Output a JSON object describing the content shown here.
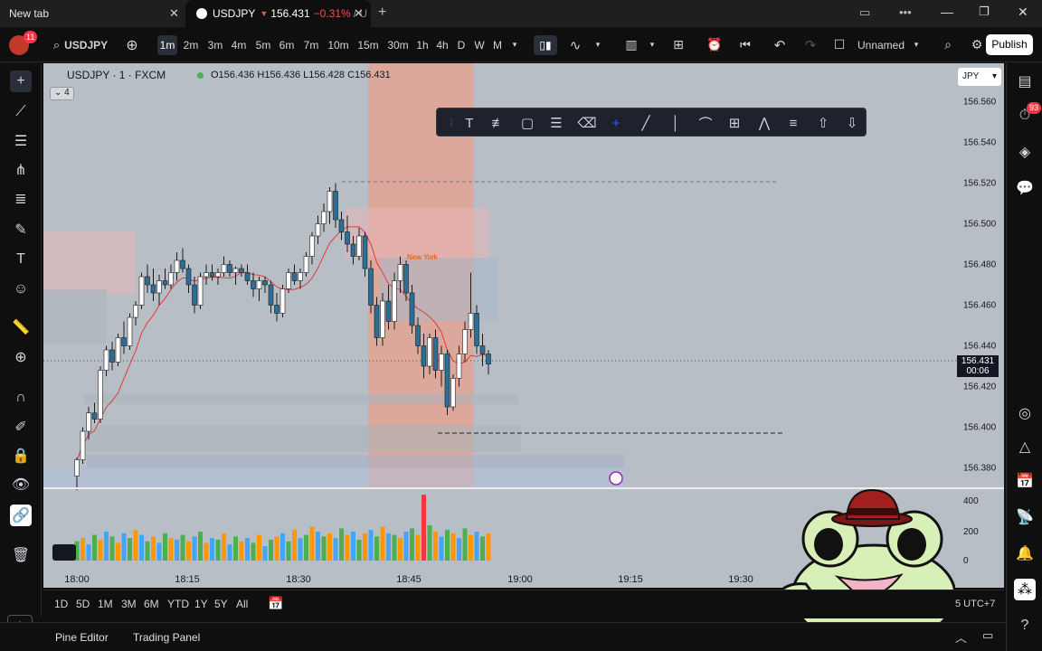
{
  "browser": {
    "tabs": [
      {
        "title": "New tab"
      },
      {
        "title": "USDJPY",
        "price": "156.431",
        "change": "−0.31%",
        "suffix": "/ U"
      }
    ]
  },
  "toolbar": {
    "notif_count": "11",
    "symbol": "USDJPY",
    "timeframes": [
      "1m",
      "2m",
      "3m",
      "4m",
      "5m",
      "6m",
      "7m",
      "10m",
      "15m",
      "30m",
      "1h",
      "4h",
      "D",
      "W",
      "M"
    ],
    "active_timeframe": "1m",
    "layout_name": "Unnamed",
    "publish_label": "Publish"
  },
  "legend": {
    "title": "USDJPY · 1 · FXCM",
    "ohlc": "O156.436 H156.436 L156.428 C156.431",
    "indicator_count": "4"
  },
  "price_axis": {
    "currency": "JPY",
    "labels": [
      "156.560",
      "156.540",
      "156.520",
      "156.500",
      "156.480",
      "156.460",
      "156.440",
      "156.420",
      "156.400",
      "156.380"
    ],
    "current_price": "156.431",
    "countdown": "00:06"
  },
  "volume_axis": {
    "labels": [
      "400",
      "200",
      "0"
    ]
  },
  "time_axis": {
    "labels": [
      "18:00",
      "18:15",
      "18:30",
      "18:45",
      "19:00",
      "19:15",
      "19:30"
    ]
  },
  "session_label": "New York",
  "range_bar": {
    "ranges": [
      "1D",
      "5D",
      "1M",
      "3M",
      "6M",
      "YTD",
      "1Y",
      "5Y",
      "All"
    ],
    "timezone": "5 UTC+7"
  },
  "bottom_panel": {
    "tabs": [
      "Pine Editor",
      "Trading Panel"
    ]
  },
  "right_sidebar": {
    "alerts_count": "93"
  },
  "colors": {
    "accent": "#2962ff",
    "down": "#ef5350",
    "candle_body": "#2b6f96",
    "publish_bg": "#ffffff"
  },
  "chart_data": {
    "type": "candlestick",
    "symbol": "USDJPY",
    "interval": "1",
    "ylim": [
      156.37,
      156.57
    ],
    "candles": [
      [
        156.376,
        156.385,
        156.365,
        156.384
      ],
      [
        156.384,
        156.4,
        156.382,
        156.398
      ],
      [
        156.398,
        156.41,
        156.394,
        156.407
      ],
      [
        156.407,
        156.412,
        156.402,
        156.404
      ],
      [
        156.404,
        156.43,
        156.402,
        156.428
      ],
      [
        156.428,
        156.44,
        156.425,
        156.438
      ],
      [
        156.438,
        156.442,
        156.428,
        156.432
      ],
      [
        156.432,
        156.446,
        156.43,
        156.444
      ],
      [
        156.444,
        156.452,
        156.436,
        156.44
      ],
      [
        156.44,
        156.456,
        156.438,
        156.454
      ],
      [
        156.454,
        156.462,
        156.45,
        156.46
      ],
      [
        156.46,
        156.476,
        156.458,
        156.474
      ],
      [
        156.474,
        156.48,
        156.466,
        156.47
      ],
      [
        156.47,
        156.478,
        156.462,
        156.466
      ],
      [
        156.466,
        156.475,
        156.46,
        156.472
      ],
      [
        156.472,
        156.478,
        156.468,
        156.47
      ],
      [
        156.47,
        156.48,
        156.468,
        156.476
      ],
      [
        156.476,
        156.486,
        156.472,
        156.482
      ],
      [
        156.482,
        156.488,
        156.476,
        156.478
      ],
      [
        156.478,
        156.48,
        156.466,
        156.47
      ],
      [
        156.47,
        156.474,
        156.456,
        156.46
      ],
      [
        156.46,
        156.476,
        156.458,
        156.474
      ],
      [
        156.474,
        156.48,
        156.47,
        156.476
      ],
      [
        156.476,
        156.48,
        156.472,
        156.474
      ],
      [
        156.474,
        156.478,
        156.47,
        156.476
      ],
      [
        156.476,
        156.484,
        156.474,
        156.48
      ],
      [
        156.48,
        156.482,
        156.474,
        156.476
      ],
      [
        156.476,
        156.479,
        156.47,
        156.478
      ],
      [
        156.478,
        156.48,
        156.474,
        156.476
      ],
      [
        156.476,
        156.48,
        156.47,
        156.472
      ],
      [
        156.472,
        156.476,
        156.464,
        156.468
      ],
      [
        156.468,
        156.474,
        156.462,
        156.472
      ],
      [
        156.472,
        156.474,
        156.466,
        156.47
      ],
      [
        156.47,
        156.472,
        156.456,
        156.46
      ],
      [
        156.46,
        156.466,
        156.452,
        156.456
      ],
      [
        156.456,
        156.47,
        156.454,
        156.468
      ],
      [
        156.468,
        156.478,
        156.466,
        156.476
      ],
      [
        156.476,
        156.48,
        156.47,
        156.472
      ],
      [
        156.472,
        156.478,
        156.468,
        156.476
      ],
      [
        156.476,
        156.486,
        156.474,
        156.484
      ],
      [
        156.484,
        156.496,
        156.48,
        156.494
      ],
      [
        156.494,
        156.504,
        156.49,
        156.5
      ],
      [
        156.5,
        156.51,
        156.496,
        156.506
      ],
      [
        156.506,
        156.518,
        156.5,
        156.516
      ],
      [
        156.516,
        156.52,
        156.498,
        156.502
      ],
      [
        156.502,
        156.506,
        156.492,
        156.496
      ],
      [
        156.496,
        156.504,
        156.486,
        156.49
      ],
      [
        156.49,
        156.494,
        156.48,
        156.484
      ],
      [
        156.484,
        156.498,
        156.482,
        156.494
      ],
      [
        156.494,
        156.496,
        156.474,
        156.478
      ],
      [
        156.478,
        156.482,
        156.456,
        156.46
      ],
      [
        156.46,
        156.464,
        156.44,
        156.444
      ],
      [
        156.444,
        156.466,
        156.44,
        156.462
      ],
      [
        156.462,
        156.47,
        156.448,
        156.452
      ],
      [
        156.452,
        156.476,
        156.448,
        156.472
      ],
      [
        156.472,
        156.484,
        156.466,
        156.48
      ],
      [
        156.48,
        156.482,
        156.462,
        156.466
      ],
      [
        156.466,
        156.47,
        156.446,
        156.45
      ],
      [
        156.45,
        156.454,
        156.436,
        156.44
      ],
      [
        156.44,
        156.446,
        156.424,
        156.43
      ],
      [
        156.43,
        156.446,
        156.426,
        156.444
      ],
      [
        156.444,
        156.448,
        156.424,
        156.428
      ],
      [
        156.428,
        156.44,
        156.42,
        156.436
      ],
      [
        156.436,
        156.438,
        156.406,
        156.41
      ],
      [
        156.41,
        156.426,
        156.408,
        156.424
      ],
      [
        156.424,
        156.44,
        156.42,
        156.436
      ],
      [
        156.436,
        156.452,
        156.432,
        156.448
      ],
      [
        156.448,
        156.476,
        156.444,
        156.456
      ],
      [
        156.456,
        156.46,
        156.436,
        156.44
      ],
      [
        156.44,
        156.446,
        156.43,
        156.436
      ],
      [
        156.436,
        156.438,
        156.426,
        156.431
      ]
    ],
    "volume": [
      120,
      140,
      100,
      160,
      130,
      180,
      150,
      110,
      170,
      140,
      190,
      160,
      120,
      150,
      110,
      170,
      140,
      130,
      160,
      120,
      150,
      180,
      110,
      140,
      130,
      170,
      100,
      150,
      120,
      140,
      110,
      160,
      90,
      130,
      150,
      170,
      120,
      190,
      140,
      160,
      210,
      180,
      150,
      170,
      140,
      200,
      160,
      180,
      130,
      170,
      190,
      150,
      210,
      170,
      160,
      140,
      180,
      200,
      160,
      410,
      220,
      180,
      150,
      190,
      170,
      140,
      200,
      160,
      180,
      150,
      170
    ],
    "session": {
      "name": "New York"
    }
  }
}
